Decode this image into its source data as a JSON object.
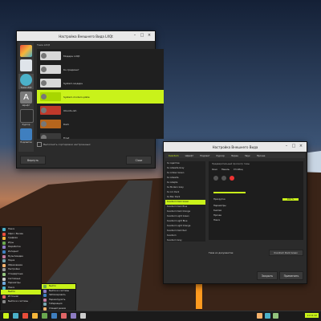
{
  "colors": {
    "accent": "#c9f21a",
    "window_bg": "#2b2b2b",
    "titlebar": "#e8e8e8",
    "taskbar": "#1b1b1b"
  },
  "window1": {
    "title": "Настройка Внешнего Вида LXQt",
    "list_header": "Тема LXQt",
    "sidebar": [
      {
        "label": "",
        "icon": "palette-icon",
        "color": "#e94d3a"
      },
      {
        "label": "",
        "icon": "monitor-icon",
        "color": "#6aa84f"
      },
      {
        "label": "Тема LXQt",
        "icon": "theme-icon",
        "color": "#4bb1c9"
      },
      {
        "label": "Шрифт",
        "icon": "font-icon",
        "color": "#7a7a7a"
      },
      {
        "label": "Курсор",
        "icon": "cursor-icon",
        "color": "#2a2a2a"
      },
      {
        "label": "Подсветка",
        "icon": "highlight-icon",
        "color": "#3f7fbf"
      }
    ],
    "themes": [
      {
        "label": "Модерн LXQt",
        "color": "#d8d8d8"
      },
      {
        "label": "Kv-градиент",
        "color": "#d8d8d8"
      },
      {
        "label": "System-модерн",
        "color": "#d8d8d8"
      },
      {
        "label": "System-modern-plate",
        "color": "#a8d600",
        "selected": true
      },
      {
        "label": "Ubuntu-ish",
        "color": "#c0392b"
      },
      {
        "label": "Dark",
        "color": "#b5651d"
      },
      {
        "label": "Frost",
        "color": "#3a3a3a"
      },
      {
        "label": "Светлая",
        "color": "#8a8a8a"
      }
    ],
    "checkbox_label": "Выполнить сортировки настроенных",
    "buttons": {
      "left": "Вернуть",
      "right": "Close"
    }
  },
  "window2": {
    "title": "Настройка Внешнего Вида",
    "tabs": [
      "Kvantum",
      "Шрифт",
      "Подсвет",
      "Курсор",
      "Экран",
      "Звук",
      "Прочее"
    ],
    "themes": [
      "Kv Адаптив",
      "Kv Adwaita Grey",
      "Kv Amber Green",
      "Kv Adwaita",
      "Kv Adapta",
      "Kv Modern Grey",
      "Kv Arc Dark",
      "Kv Blur Dark",
      "Kvantum Dark Green",
      "Kvantum Dark Blue",
      "Kvantum Dark Orange",
      "Kvantum Light Green",
      "Kvantum Light Blue",
      "Kvantum Light Orange",
      "Kvantum Dark Red",
      "Kvantum",
      "Kvantum Grey",
      "Kvantum Light",
      "Kvantum Blue"
    ],
    "selected_theme_index": 8,
    "preview": {
      "header": "Предварительный просмотр темы",
      "subtabs": [
        "Окно",
        "Панель",
        "Столбец"
      ],
      "value_label": "Прокрутка",
      "value": "100 %",
      "items": [
        "Параметры",
        "Кнопки",
        "Прочее",
        "Поиск"
      ]
    },
    "theme_select_label": "Тема из документов:",
    "theme_select_value": "Kvantum Dark Green",
    "buttons": {
      "cancel": "Закрыть",
      "apply": "Применить"
    }
  },
  "menu": {
    "items": [
      "Поиск",
      "Офис / Bureau",
      "Графика",
      "Игры",
      "Разработка",
      "Интернет",
      "Мультимедиа",
      "Наука",
      "Образование",
      "Настройки",
      "Стандартные",
      "Системные",
      "Параметры",
      "Поиск",
      "Выйти",
      "Источник",
      "Выйти из системы"
    ],
    "selected_index": 14,
    "submenu": [
      "Выйти",
      "Выйти из системы",
      "Заблокировать",
      "Перезагрузить",
      "Гибернация",
      "Спящий режим"
    ],
    "submenu_selected": 0
  },
  "taskbar": {
    "clock": "11:11:12"
  }
}
